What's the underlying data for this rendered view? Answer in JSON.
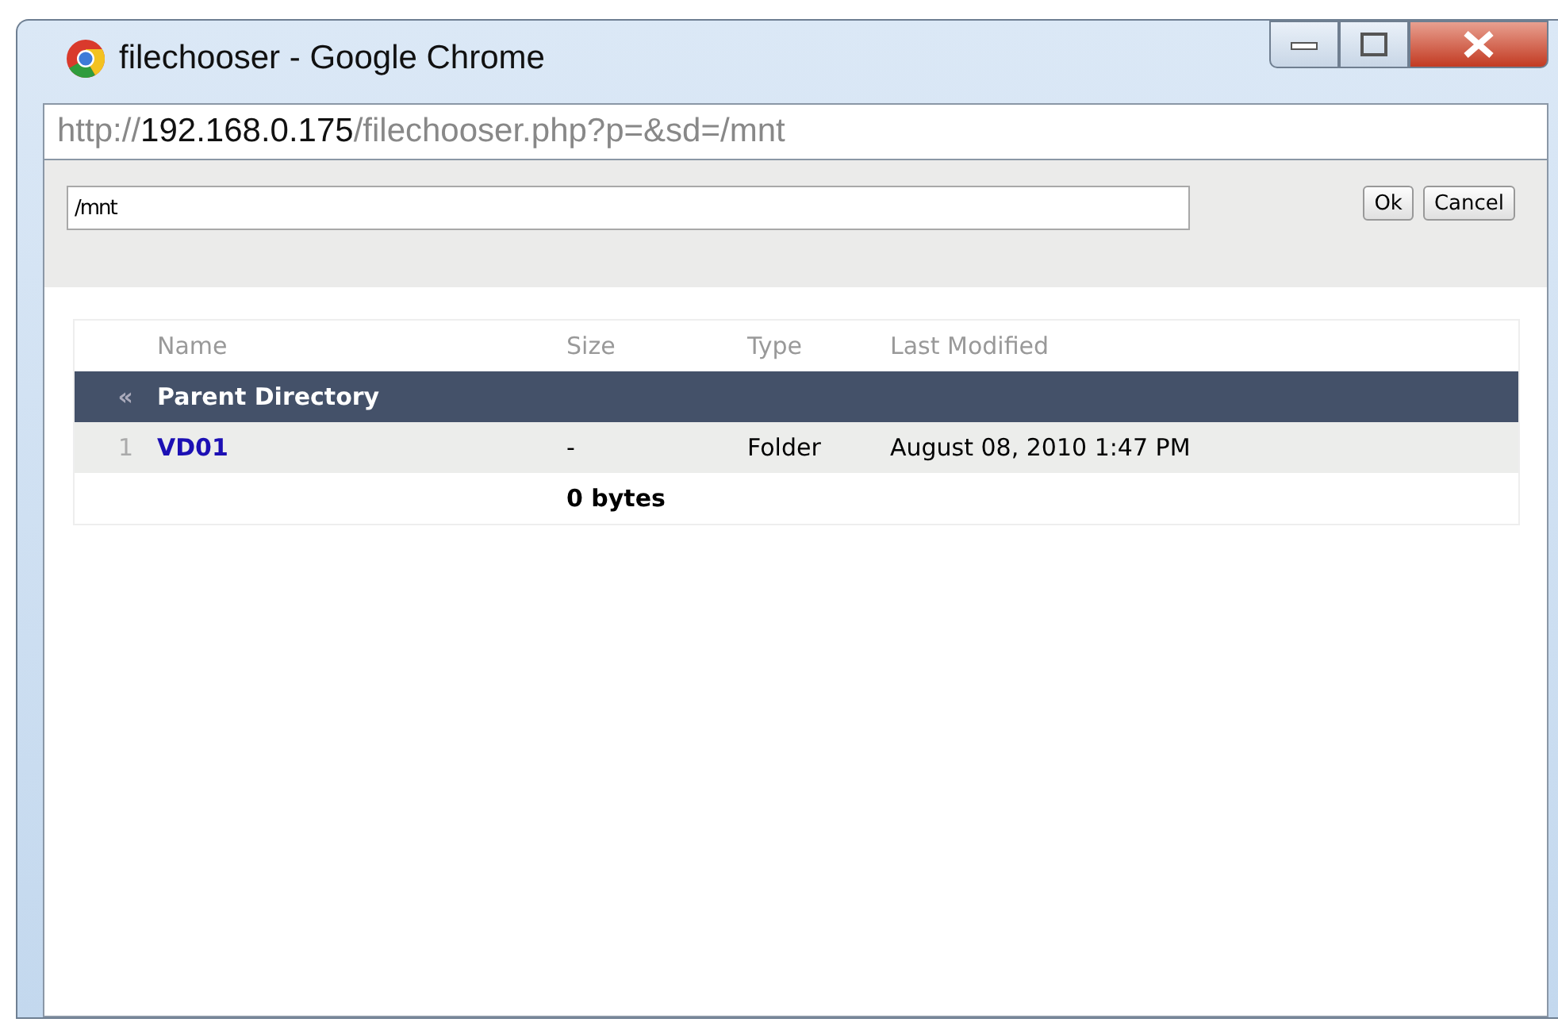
{
  "window": {
    "title": "filechooser - Google Chrome"
  },
  "address": {
    "scheme": "http://",
    "host": "192.168.0.175",
    "path": "/filechooser.php?p=&sd=/mnt"
  },
  "path_field": {
    "value": "/mnt"
  },
  "buttons": [
    "Ok",
    "Cancel"
  ],
  "table": {
    "columns": [
      "Name",
      "Size",
      "Type",
      "Last Modified"
    ],
    "parent": {
      "marker": "«",
      "label": "Parent Directory"
    },
    "rows": [
      {
        "index": "1",
        "name": "VD01",
        "size": "-",
        "type": "Folder",
        "modified": "August 08, 2010 1:47 PM"
      }
    ],
    "total": "0 bytes"
  }
}
